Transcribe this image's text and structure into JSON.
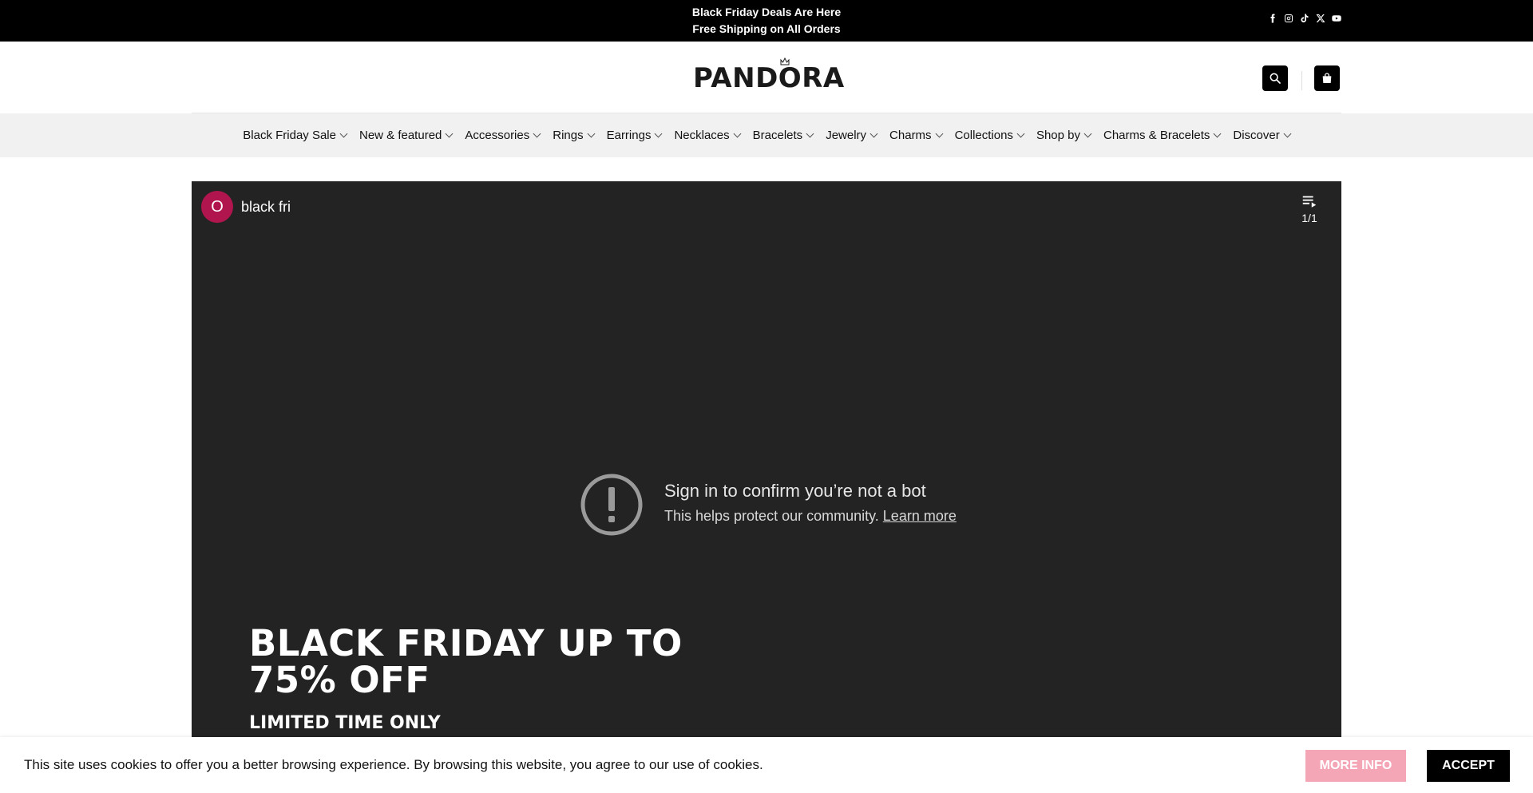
{
  "topbar": {
    "promo_line1": "Black Friday Deals Are Here",
    "promo_line2": "Free Shipping on All Orders",
    "social_icons": [
      "facebook-icon",
      "instagram-icon",
      "tiktok-icon",
      "x-icon",
      "youtube-icon"
    ]
  },
  "header": {
    "logo_text": "PANDORA",
    "search_icon": "search-icon",
    "cart_icon": "shopping-bag-icon"
  },
  "nav": {
    "items": [
      {
        "label": "Black Friday Sale"
      },
      {
        "label": "New & featured"
      },
      {
        "label": "Accessories"
      },
      {
        "label": "Rings"
      },
      {
        "label": "Earrings"
      },
      {
        "label": "Necklaces"
      },
      {
        "label": "Bracelets"
      },
      {
        "label": "Jewelry"
      },
      {
        "label": "Charms"
      },
      {
        "label": "Collections"
      },
      {
        "label": "Shop by"
      },
      {
        "label": "Charms & Bracelets"
      },
      {
        "label": "Discover"
      }
    ]
  },
  "video": {
    "channel_initial": "O",
    "channel_title": "black fri",
    "playlist_count": "1/1",
    "bot_title": "Sign in to confirm you’re not a bot",
    "bot_text": "This helps protect our community.",
    "bot_link": "Learn more",
    "hero_title": "BLACK FRIDAY UP TO 75% OFF",
    "hero_subtitle": "LIMITED TIME ONLY"
  },
  "cookie": {
    "message": "This site uses cookies to offer you a better browsing experience. By browsing this website, you agree to our use of cookies.",
    "more_info": "MORE INFO",
    "accept": "ACCEPT"
  },
  "colors": {
    "topbar": "#000000",
    "nav_bg": "#f1f1f1",
    "video_bg": "#232323",
    "avatar": "#b0154d",
    "more_info": "#f4a6b7",
    "accept": "#000000"
  }
}
